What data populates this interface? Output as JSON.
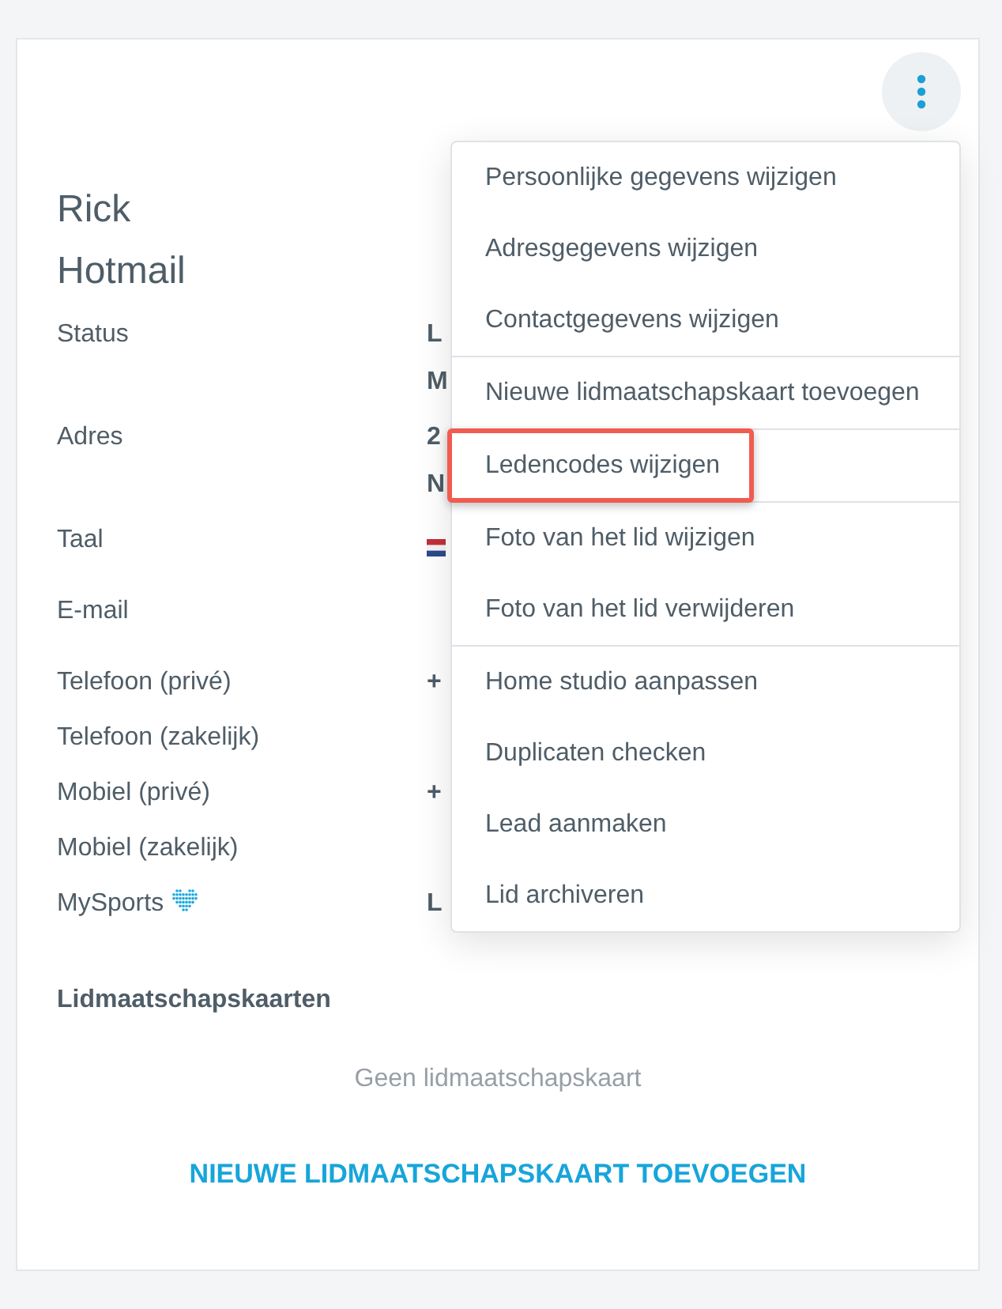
{
  "member": {
    "first_name": "Rick",
    "last_name": "Hotmail"
  },
  "details": [
    {
      "label": "Status",
      "kind": "text",
      "values": [
        "L",
        "M"
      ]
    },
    {
      "label": "Adres",
      "kind": "text",
      "values": [
        "2",
        "N"
      ]
    },
    {
      "label": "Taal",
      "kind": "flag"
    },
    {
      "label": "E-mail",
      "kind": "empty"
    },
    {
      "label": "Telefoon (privé)",
      "kind": "text",
      "values": [
        "+"
      ]
    },
    {
      "label": "Telefoon (zakelijk)",
      "kind": "text"
    },
    {
      "label": "Mobiel (privé)",
      "kind": "text",
      "values": [
        "+"
      ]
    },
    {
      "label": "Mobiel (zakelijk)",
      "kind": "text"
    },
    {
      "label": "MySports",
      "kind": "text",
      "icon": true,
      "values": [
        "L"
      ]
    }
  ],
  "cards_section": {
    "title": "Lidmaatschapskaarten",
    "empty_text": "Geen lidmaatschapskaart",
    "add_button": "NIEUWE LIDMAATSCHAPSKAART TOEVOEGEN"
  },
  "menu": {
    "groups": [
      [
        {
          "label": "Persoonlijke gegevens wijzigen",
          "highlighted": false
        },
        {
          "label": "Adresgegevens wijzigen",
          "highlighted": false
        },
        {
          "label": "Contactgegevens wijzigen",
          "highlighted": false
        }
      ],
      [
        {
          "label": "Nieuwe lidmaatschapskaart toevoegen",
          "highlighted": false
        }
      ],
      [
        {
          "label": "Ledencodes wijzigen",
          "highlighted": true
        }
      ],
      [
        {
          "label": "Foto van het lid wijzigen",
          "highlighted": false
        },
        {
          "label": "Foto van het lid verwijderen",
          "highlighted": false
        }
      ],
      [
        {
          "label": "Home studio aanpassen",
          "highlighted": false
        },
        {
          "label": "Duplicaten checken",
          "highlighted": false
        },
        {
          "label": "Lead aanmaken",
          "highlighted": false
        },
        {
          "label": "Lid archiveren",
          "highlighted": false
        }
      ]
    ]
  }
}
